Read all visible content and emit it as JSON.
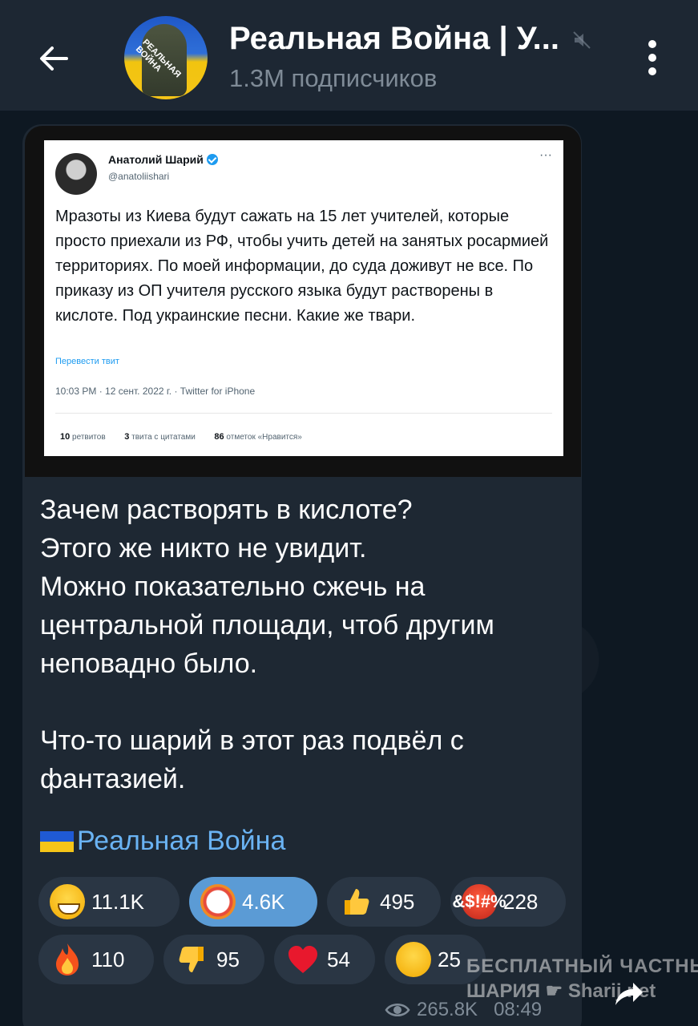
{
  "header": {
    "title": "Реальная Война | У...",
    "subscribers": "1.3M подписчиков",
    "avatar_text": "РЕАЛЬНАЯ ВОЙНА"
  },
  "tweet": {
    "name": "Анатолий Шарий",
    "handle": "@anatoliishari",
    "more": "···",
    "text": "Мразоты из Киева будут сажать на 15 лет учителей, которые просто приехали из РФ, чтобы учить детей на занятых росармией территориях. По моей информации, до суда доживут не все. По приказу из ОП учителя русского языка будут растворены в кислоте. Под украинские песни. Какие же твари.",
    "translate": "Перевести твит",
    "meta": "10:03 PM · 12 сент. 2022 г. · Twitter for iPhone",
    "retweets_count": "10",
    "retweets_label": "ретвитов",
    "quotes_count": "3",
    "quotes_label": "твита с цитатами",
    "likes_count": "86",
    "likes_label": "отметок «Нравится»"
  },
  "message": {
    "text": "Зачем растворять в кислоте?\nЭтого же никто не увидит.\nМожно показательно сжечь на центральной площади, чтоб другим неповадно было.\n\nЧто-то шарий в этот раз подвёл с фантазией.",
    "signature": "Реальная Война"
  },
  "reactions": [
    {
      "emoji": "grinning-face",
      "count": "11.1K",
      "selected": false
    },
    {
      "emoji": "clown-face",
      "count": "4.6K",
      "selected": true
    },
    {
      "emoji": "thumbs-up",
      "count": "495",
      "selected": false
    },
    {
      "emoji": "cursing-face",
      "count": "228",
      "selected": false,
      "label": "&$!#%"
    },
    {
      "emoji": "fire",
      "count": "110",
      "selected": false
    },
    {
      "emoji": "thumbs-down",
      "count": "95",
      "selected": false
    },
    {
      "emoji": "red-heart",
      "count": "54",
      "selected": false
    },
    {
      "emoji": "crying-face",
      "count": "25",
      "selected": false
    }
  ],
  "footer": {
    "views": "265.8K",
    "time": "08:49"
  },
  "watermark": {
    "line1": "БЕСПЛАТНЫЙ ЧАСТНЫЙ",
    "line2": "ШАРИЯ",
    "line2_site": "Sharij.net"
  },
  "colors": {
    "header_bg": "#1d2733",
    "bubble_bg": "#1e2833",
    "link": "#6ab3f3",
    "reaction_bg": "#2a3644",
    "reaction_selected": "#5b9bd5"
  }
}
